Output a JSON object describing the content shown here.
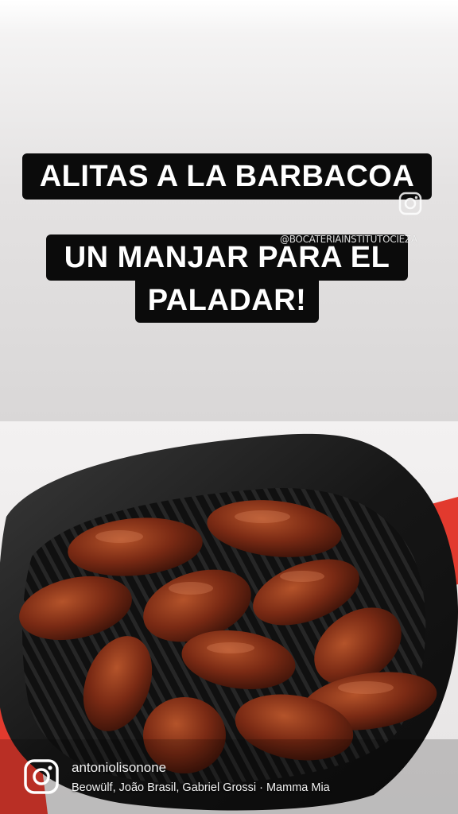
{
  "captions": {
    "line1": "ALITAS A LA BARBACOA",
    "line2a": "UN MANJAR PARA EL",
    "line2b": "PALADAR!"
  },
  "watermark": {
    "handle": "@BOCATERIAINSTITUTOCIEZA",
    "icon": "instagram-icon"
  },
  "footer": {
    "icon": "instagram-icon",
    "username": "antoniolisonone",
    "audio": "Beowülf, João Brasil, Gabriel Grossi · Mamma Mia"
  },
  "colors": {
    "caption_bg": "#0b0b0b",
    "caption_text": "#ffffff",
    "pan": "#1a1a1a",
    "pan_handle": "#e23a2e",
    "wings": "#7a2a14"
  }
}
